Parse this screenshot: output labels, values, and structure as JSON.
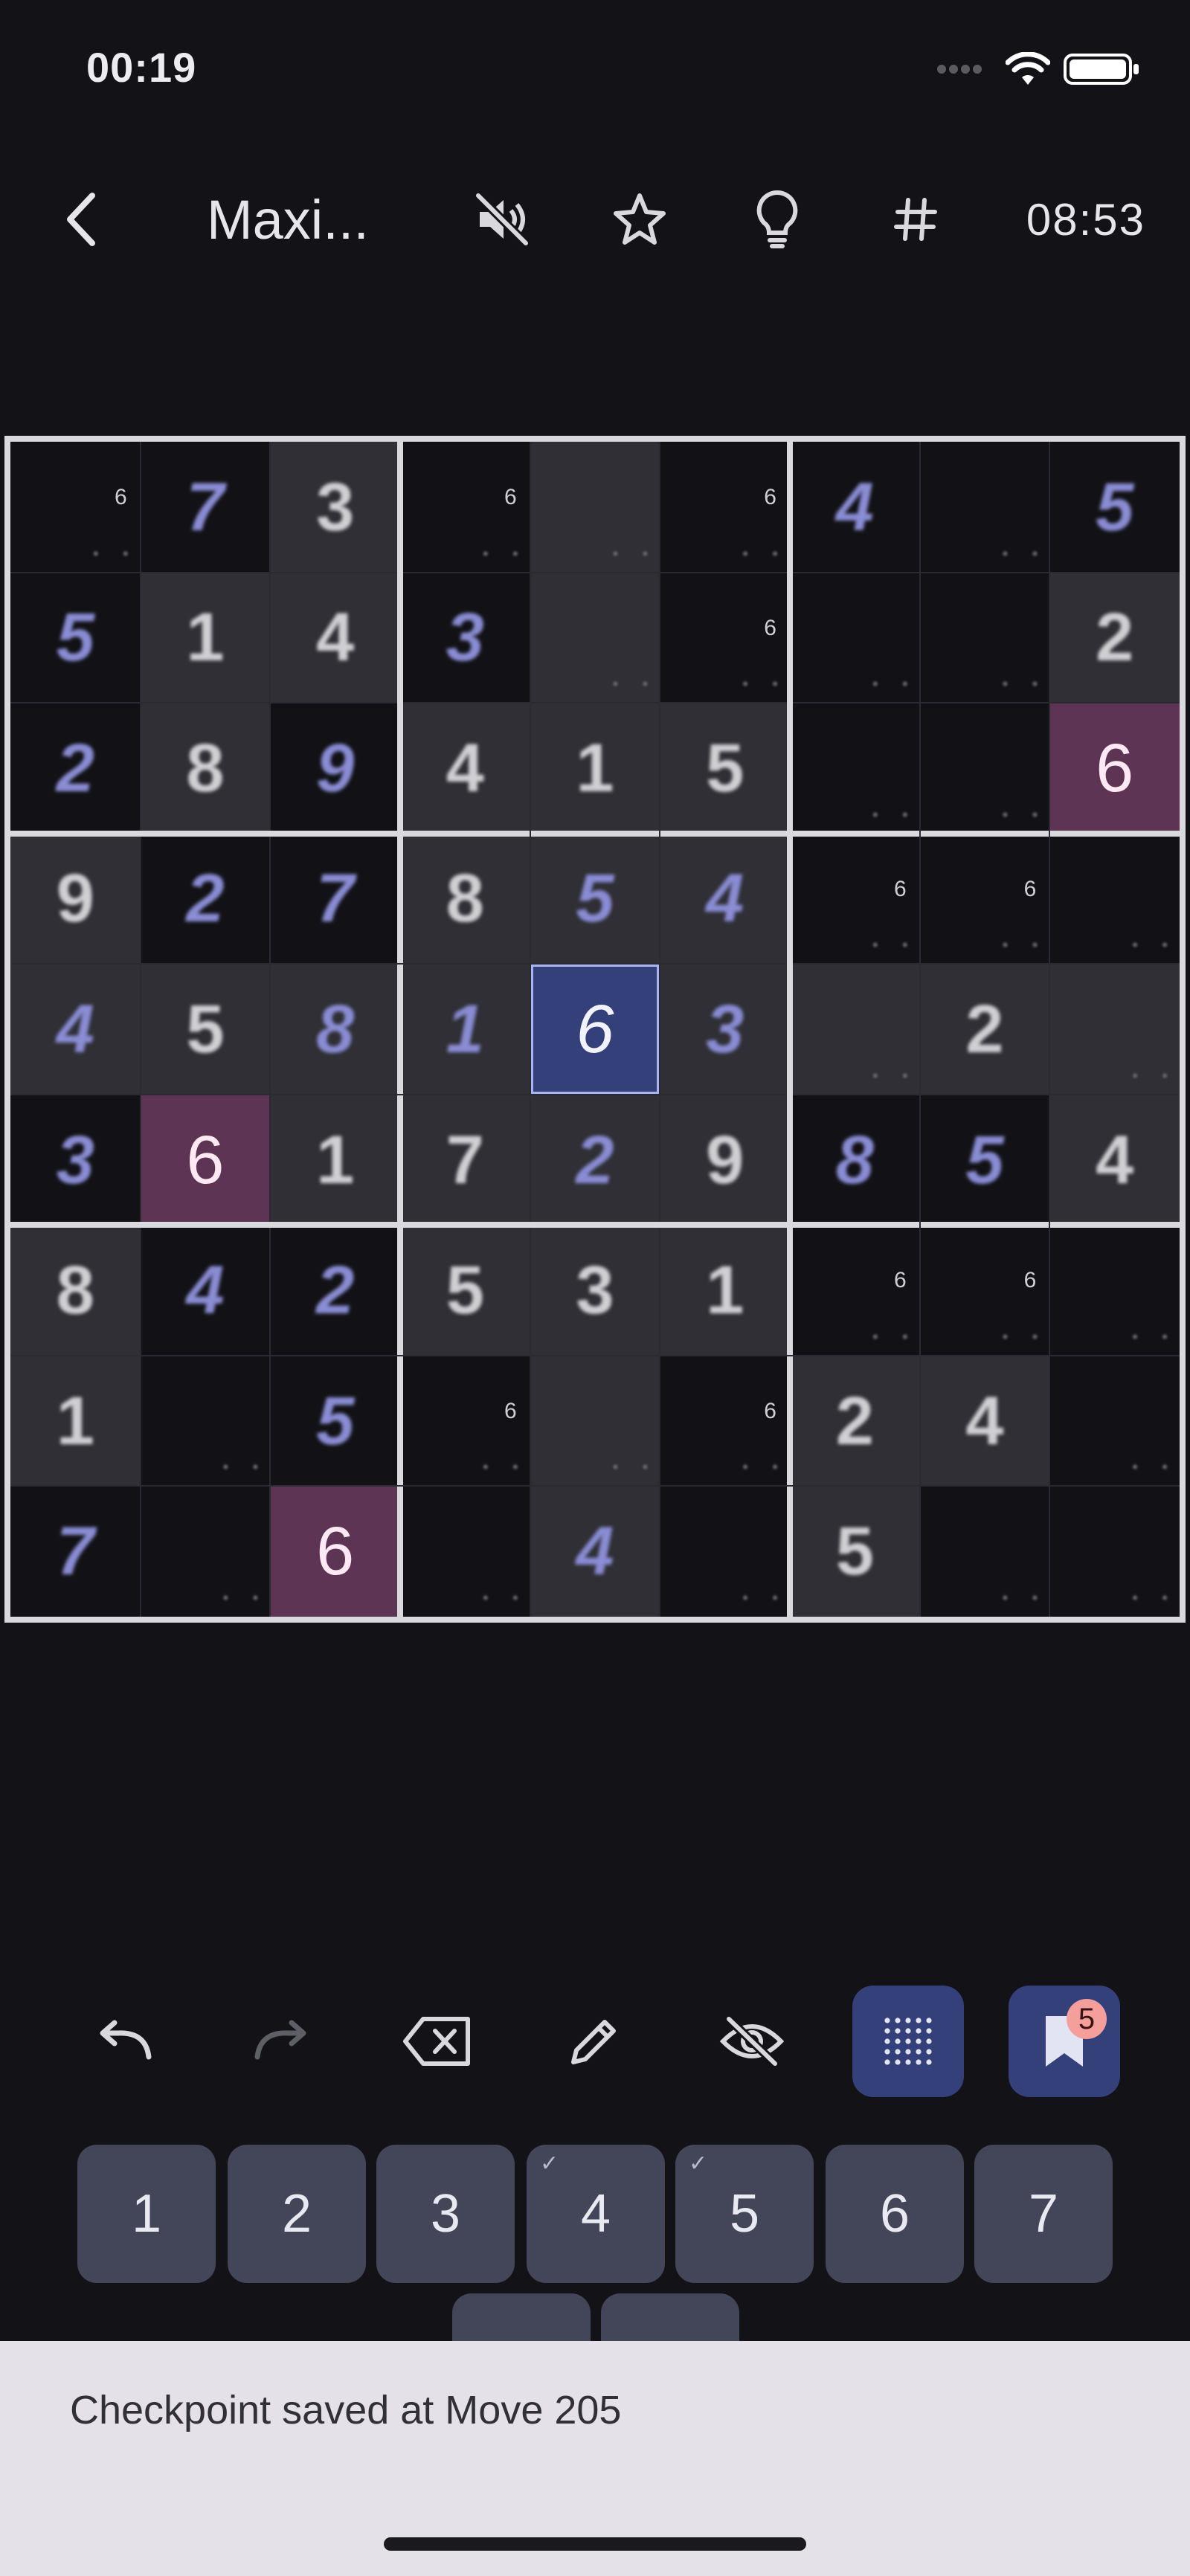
{
  "status_bar": {
    "time": "00:19"
  },
  "top_bar": {
    "back_icon": "chevron-left-icon",
    "title": "Maxi...",
    "icons": [
      "sound-off-icon",
      "star-icon",
      "hint-bulb-icon",
      "grid-hash-icon"
    ],
    "timer": "08:53"
  },
  "board": {
    "rows": [
      [
        "",
        "7",
        "3",
        "",
        "",
        "",
        "4",
        "",
        "5"
      ],
      [
        "5",
        "1",
        "4",
        "3",
        "",
        "",
        "",
        "",
        "2"
      ],
      [
        "2",
        "8",
        "9",
        "4",
        "1",
        "5",
        "",
        "",
        "6"
      ],
      [
        "9",
        "2",
        "7",
        "8",
        "5",
        "4",
        "",
        "",
        ""
      ],
      [
        "4",
        "5",
        "8",
        "1",
        "6",
        "3",
        "",
        "2",
        ""
      ],
      [
        "3",
        "6",
        "1",
        "7",
        "2",
        "9",
        "8",
        "5",
        "4"
      ],
      [
        "8",
        "4",
        "2",
        "5",
        "3",
        "1",
        "",
        "",
        ""
      ],
      [
        "1",
        "",
        "5",
        "",
        "",
        "",
        "2",
        "4",
        ""
      ],
      [
        "7",
        "",
        "6",
        "",
        "4",
        "",
        "5",
        "",
        ""
      ]
    ],
    "notes": [
      [
        "6",
        "",
        "",
        "6",
        "",
        "6",
        "",
        "",
        ""
      ],
      [
        "",
        "",
        "",
        "",
        "",
        "6",
        "",
        "",
        ""
      ],
      [
        "",
        "",
        "",
        "",
        "",
        "",
        "",
        "",
        ""
      ],
      [
        "",
        "",
        "",
        "",
        "",
        "",
        "6",
        "6",
        ""
      ],
      [
        "",
        "",
        "",
        "",
        "",
        "",
        "",
        "",
        ""
      ],
      [
        "",
        "",
        "",
        "",
        "",
        "",
        "",
        "",
        ""
      ],
      [
        "",
        "",
        "",
        "",
        "",
        "",
        "6",
        "6",
        ""
      ],
      [
        "",
        "",
        "",
        "6",
        "",
        "6",
        "",
        "",
        ""
      ],
      [
        "",
        "",
        "",
        "",
        "",
        "",
        "",
        "",
        ""
      ]
    ],
    "selected_cell": "r5c5",
    "highlight_color": "#5d3453",
    "selected_color": "#34407a"
  },
  "tools": [
    {
      "name": "undo-icon"
    },
    {
      "name": "redo-icon"
    },
    {
      "name": "erase-icon"
    },
    {
      "name": "pencil-icon"
    },
    {
      "name": "hide-icon"
    },
    {
      "name": "dots-grid-icon"
    },
    {
      "name": "bookmark-icon",
      "badge": "5"
    }
  ],
  "numpad": {
    "keys": [
      "1",
      "2",
      "3",
      "4",
      "5",
      "6",
      "7"
    ],
    "completed": [
      "4",
      "5"
    ]
  },
  "snackbar": {
    "message": "Checkpoint saved at Move 205"
  }
}
